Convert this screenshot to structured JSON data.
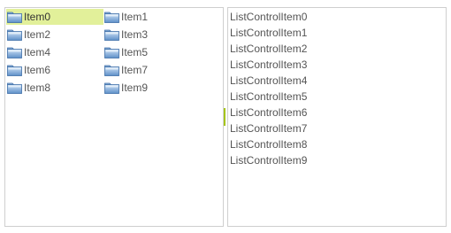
{
  "icon_list": {
    "items": [
      {
        "label": "Item0",
        "icon": "folder-icon",
        "selected": true
      },
      {
        "label": "Item1",
        "icon": "folder-icon",
        "selected": false
      },
      {
        "label": "Item2",
        "icon": "folder-icon",
        "selected": false
      },
      {
        "label": "Item3",
        "icon": "folder-icon",
        "selected": false
      },
      {
        "label": "Item4",
        "icon": "folder-icon",
        "selected": false
      },
      {
        "label": "Item5",
        "icon": "folder-icon",
        "selected": false
      },
      {
        "label": "Item6",
        "icon": "folder-icon",
        "selected": false
      },
      {
        "label": "Item7",
        "icon": "folder-icon",
        "selected": false
      },
      {
        "label": "Item8",
        "icon": "folder-icon",
        "selected": false
      },
      {
        "label": "Item9",
        "icon": "folder-icon",
        "selected": false
      }
    ]
  },
  "list_control": {
    "items": [
      {
        "label": "ListControlItem0"
      },
      {
        "label": "ListControlItem1"
      },
      {
        "label": "ListControlItem2"
      },
      {
        "label": "ListControlItem3"
      },
      {
        "label": "ListControlItem4"
      },
      {
        "label": "ListControlItem5"
      },
      {
        "label": "ListControlItem6"
      },
      {
        "label": "ListControlItem7"
      },
      {
        "label": "ListControlItem8"
      },
      {
        "label": "ListControlItem9"
      }
    ]
  },
  "colors": {
    "selection": "#e2f09a",
    "splitter_accent": "#a6c41b",
    "border": "#cfcfcf",
    "text": "#555555"
  }
}
